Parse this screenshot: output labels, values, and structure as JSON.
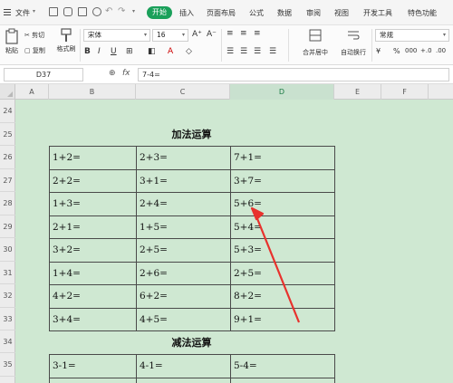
{
  "menubar": {
    "file": "文件",
    "tabs": [
      "开始",
      "插入",
      "页面布局",
      "公式",
      "数据",
      "审阅",
      "视图",
      "开发工具",
      "特色功能"
    ]
  },
  "ribbon": {
    "paste": "粘贴",
    "cut": "剪切",
    "copy": "复制",
    "format_painter": "格式刷",
    "font_name": "宋体",
    "font_size": "16",
    "merge_center": "合并居中",
    "wrap_text": "自动换行",
    "number_format": "常规",
    "number_symbols": [
      "¥",
      "%",
      "000",
      "+.0",
      ".00"
    ]
  },
  "formula_bar": {
    "cell_ref": "D37",
    "fx_label": "fx",
    "formula": "7-4="
  },
  "columns": [
    "A",
    "B",
    "C",
    "D",
    "E",
    "F"
  ],
  "rows": [
    "24",
    "25",
    "26",
    "27",
    "28",
    "29",
    "30",
    "31",
    "32",
    "33",
    "34",
    "35",
    "36"
  ],
  "sheet": {
    "addition_title": "加法运算",
    "addition_rows": [
      [
        "1+2=",
        "2+3=",
        "7+1="
      ],
      [
        "2+2=",
        "3+1=",
        "3+7="
      ],
      [
        "1+3=",
        "2+4=",
        "5+6="
      ],
      [
        "2+1=",
        "1+5=",
        "5+4="
      ],
      [
        "3+2=",
        "2+5=",
        "5+3="
      ],
      [
        "1+4=",
        "2+6=",
        "2+5="
      ],
      [
        "4+2=",
        "6+2=",
        "8+2="
      ],
      [
        "3+4=",
        "4+5=",
        "9+1="
      ]
    ],
    "subtraction_title": "减法运算",
    "subtraction_rows": [
      [
        "3-1=",
        "4-1=",
        "5-4="
      ],
      [
        "",
        "",
        ""
      ]
    ]
  },
  "colors": {
    "accent": "#1aa05a",
    "sheet_bg": "#cfe8d2",
    "arrow": "#e8322d"
  }
}
